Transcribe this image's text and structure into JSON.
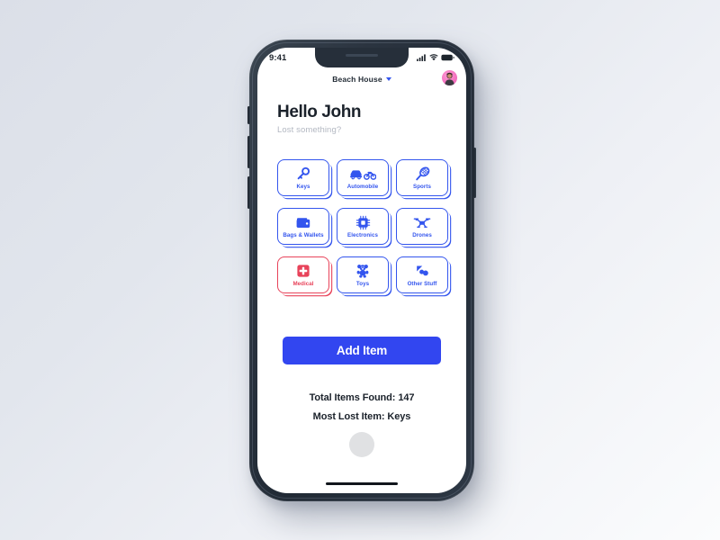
{
  "device": {
    "frame_color": "#2b3440",
    "screen_background": "#ffffff",
    "page_background": "#dde1ea"
  },
  "status_bar": {
    "time": "9:41",
    "signal_icon": "cellular-signal-icon",
    "wifi_icon": "wifi-icon",
    "battery_icon": "battery-icon"
  },
  "header": {
    "location_name": "Beach House",
    "dropdown_icon": "chevron-down-icon",
    "avatar_icon": "user-avatar"
  },
  "greeting": {
    "title": "Hello John",
    "subtitle": "Lost something?"
  },
  "categories": [
    {
      "label": "Keys",
      "icon": "key-icon",
      "color": "#3355ee"
    },
    {
      "label": "Automobile",
      "icon": "car-motorcycle-icon",
      "color": "#3355ee"
    },
    {
      "label": "Sports",
      "icon": "racket-icon",
      "color": "#3355ee"
    },
    {
      "label": "Bags & Wallets",
      "icon": "wallet-icon",
      "color": "#3355ee"
    },
    {
      "label": "Electronics",
      "icon": "chip-icon",
      "color": "#3355ee"
    },
    {
      "label": "Drones",
      "icon": "drone-icon",
      "color": "#3355ee"
    },
    {
      "label": "Medical",
      "icon": "medical-cross-icon",
      "color": "#e8435a"
    },
    {
      "label": "Toys",
      "icon": "teddy-bear-icon",
      "color": "#3355ee"
    },
    {
      "label": "Other Stuff",
      "icon": "shapes-icon",
      "color": "#3355ee"
    }
  ],
  "primary_action": {
    "label": "Add Item",
    "color": "#3246f0"
  },
  "stats": {
    "total_items_label": "Total Items Found:",
    "total_items_value": "147",
    "most_lost_label": "Most Lost Item:",
    "most_lost_value": "Keys"
  }
}
